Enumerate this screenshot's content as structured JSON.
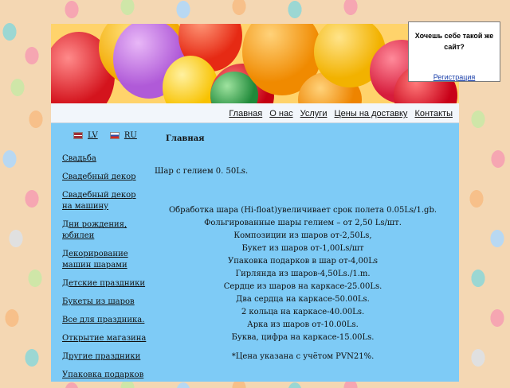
{
  "popup": {
    "question": "Хочешь себе такой же сайт?",
    "register": "Регистрация"
  },
  "topnav": [
    "Главная",
    "О нас",
    "Услуги",
    "Цены на доставку",
    "Контакты"
  ],
  "langs": [
    "LV",
    "RU"
  ],
  "sidebar": [
    "Свадьба",
    "Свадебный декор",
    "Свадебный декор на машину",
    "Дни рождения, юбилеи",
    "Декорирование машин шарами",
    "Детские праздники",
    "Букеты из шаров",
    "Все для праздника.",
    "Открытие магазина",
    "Другие праздники",
    "Упаковка подарков"
  ],
  "content": {
    "title": "Главная",
    "first_line": "Шар с гелием 0. 50Ls.",
    "lines": [
      "Обработка шара (Hi-float)увеличивает срок полета 0.05Ls/1.gb.",
      "Фольгированные шары гелием – от 2,50 Ls/шт.",
      "Композиции из шаров от-2,50Ls,",
      "Букет из шаров от-1,00Ls/шт",
      "Упаковка подарков в шар от-4,00Ls",
      "Гирлянда из шаров-4,50Ls./1.m.",
      "Сердце из шаров на каркасе-25.00Ls.",
      "Два сердца на каркасе-50.00Ls.",
      "2 кольца на каркасе-40.00Ls.",
      "Арка из шаров от-10.00Ls.",
      "Буква, цифра на каркасе-15.00Ls."
    ],
    "note": "*Цена указана с учётом PVN21%."
  }
}
